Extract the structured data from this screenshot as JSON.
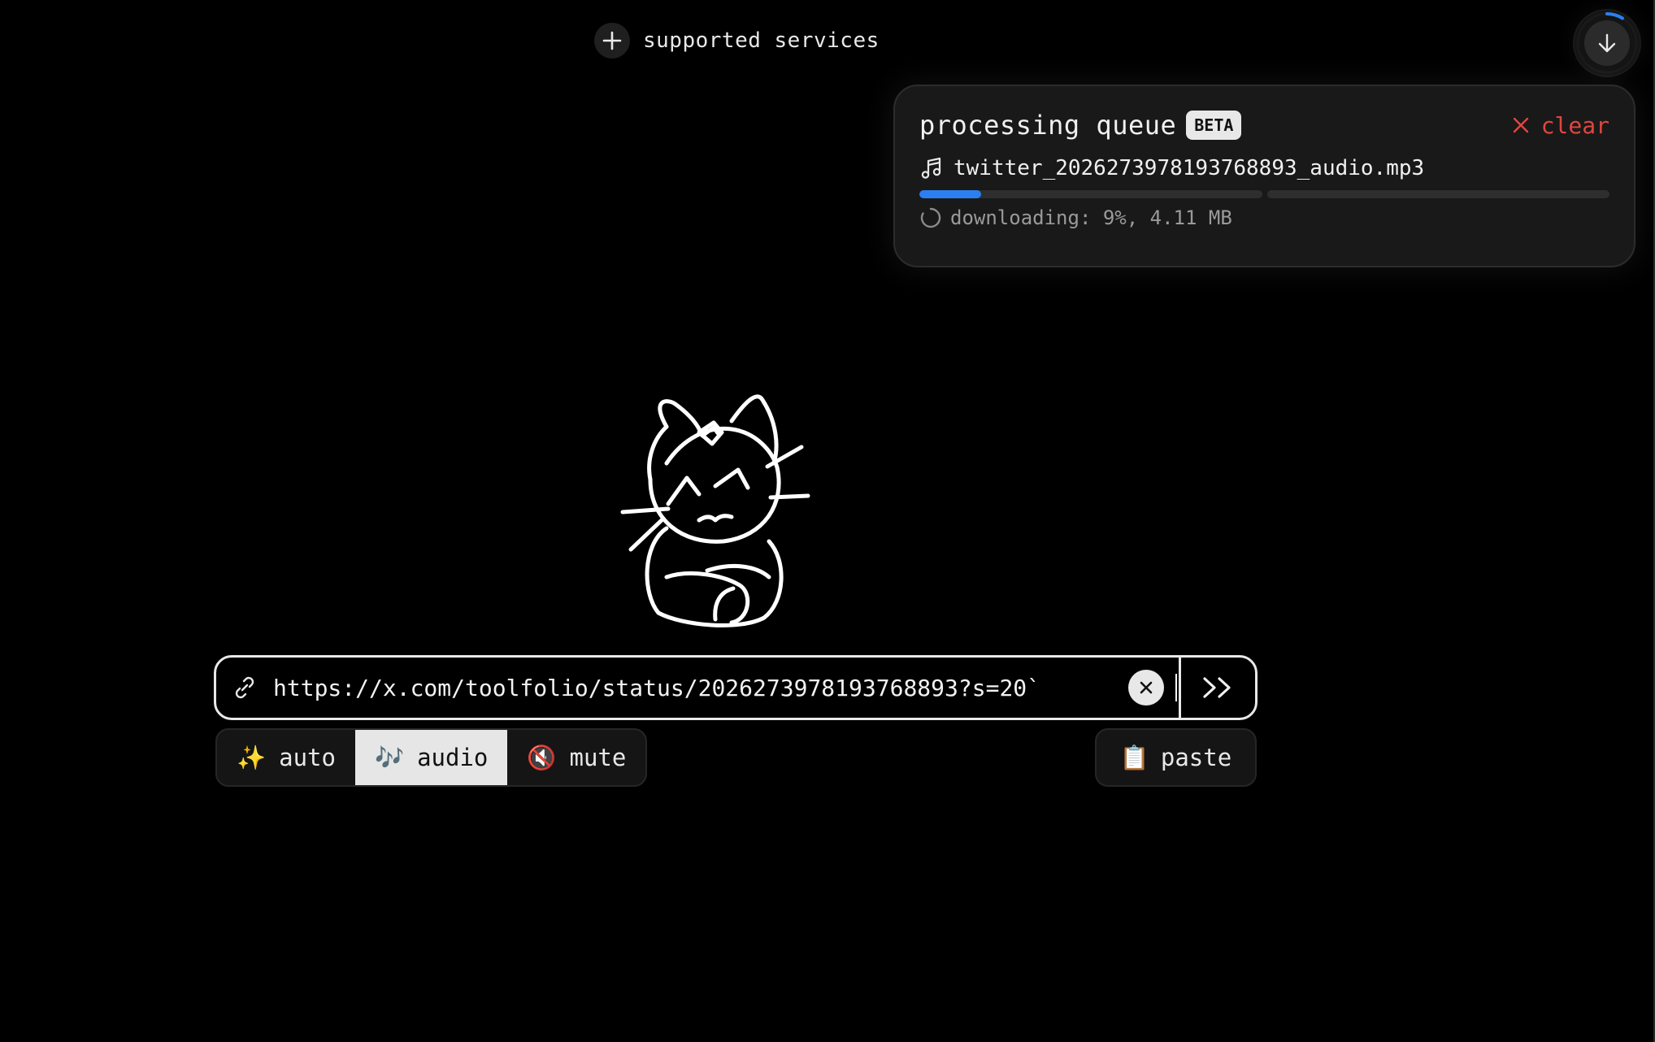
{
  "header": {
    "services_label": "supported services",
    "plus_icon": "plus-icon",
    "download_icon": "arrow-down-icon"
  },
  "queue": {
    "title": "processing queue",
    "badge": "BETA",
    "clear_label": "clear",
    "items": [
      {
        "icon": "music-note-icon",
        "filename": "twitter_2026273978193768893_audio.mp3",
        "status": "downloading: 9%, 4.11 MB",
        "progress": 0.18,
        "segments_total": 2
      }
    ]
  },
  "input": {
    "value": "https://x.com/toolfolio/status/2026273978193768893?s=20`"
  },
  "modes": [
    {
      "label": "auto",
      "emoji": "✨",
      "active": false
    },
    {
      "label": "audio",
      "emoji": "🎶",
      "active": true
    },
    {
      "label": "mute",
      "emoji": "🔇",
      "active": false
    }
  ],
  "paste": {
    "label": "paste",
    "emoji": "📋"
  },
  "colors": {
    "accent_blue": "#2b7ff0",
    "clear_red": "#e0463e",
    "background": "#000000"
  }
}
